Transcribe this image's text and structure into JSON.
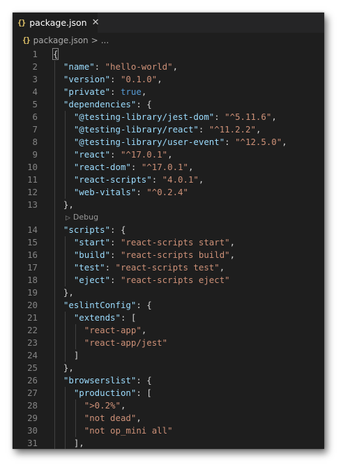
{
  "tab": {
    "icon": "json-braces-icon",
    "icon_text": "{}",
    "label": "package.json",
    "close_symbol": "✕"
  },
  "breadcrumb": {
    "icon_text": "{}",
    "file": "package.json",
    "separator": ">",
    "more": "..."
  },
  "codelens": {
    "label": "Debug",
    "icon": "play-icon"
  },
  "lines": [
    {
      "n": "1",
      "tokens": [
        {
          "t": "{",
          "c": "p"
        }
      ]
    },
    {
      "n": "2",
      "tokens": [
        {
          "t": "\"name\"",
          "c": "k"
        },
        {
          "t": ": ",
          "c": "p"
        },
        {
          "t": "\"hello-world\"",
          "c": "s"
        },
        {
          "t": ",",
          "c": "p"
        }
      ]
    },
    {
      "n": "3",
      "tokens": [
        {
          "t": "\"version\"",
          "c": "k"
        },
        {
          "t": ": ",
          "c": "p"
        },
        {
          "t": "\"0.1.0\"",
          "c": "s"
        },
        {
          "t": ",",
          "c": "p"
        }
      ]
    },
    {
      "n": "4",
      "tokens": [
        {
          "t": "\"private\"",
          "c": "k"
        },
        {
          "t": ": ",
          "c": "p"
        },
        {
          "t": "true",
          "c": "b"
        },
        {
          "t": ",",
          "c": "p"
        }
      ]
    },
    {
      "n": "5",
      "tokens": [
        {
          "t": "\"dependencies\"",
          "c": "k"
        },
        {
          "t": ": {",
          "c": "p"
        }
      ]
    },
    {
      "n": "6",
      "tokens": [
        {
          "t": "\"@testing-library/jest-dom\"",
          "c": "k"
        },
        {
          "t": ": ",
          "c": "p"
        },
        {
          "t": "\"^5.11.6\"",
          "c": "s"
        },
        {
          "t": ",",
          "c": "p"
        }
      ]
    },
    {
      "n": "7",
      "tokens": [
        {
          "t": "\"@testing-library/react\"",
          "c": "k"
        },
        {
          "t": ": ",
          "c": "p"
        },
        {
          "t": "\"^11.2.2\"",
          "c": "s"
        },
        {
          "t": ",",
          "c": "p"
        }
      ]
    },
    {
      "n": "8",
      "tokens": [
        {
          "t": "\"@testing-library/user-event\"",
          "c": "k"
        },
        {
          "t": ": ",
          "c": "p"
        },
        {
          "t": "\"^12.5.0\"",
          "c": "s"
        },
        {
          "t": ",",
          "c": "p"
        }
      ]
    },
    {
      "n": "9",
      "tokens": [
        {
          "t": "\"react\"",
          "c": "k"
        },
        {
          "t": ": ",
          "c": "p"
        },
        {
          "t": "\"^17.0.1\"",
          "c": "s"
        },
        {
          "t": ",",
          "c": "p"
        }
      ]
    },
    {
      "n": "10",
      "tokens": [
        {
          "t": "\"react-dom\"",
          "c": "k"
        },
        {
          "t": ": ",
          "c": "p"
        },
        {
          "t": "\"^17.0.1\"",
          "c": "s"
        },
        {
          "t": ",",
          "c": "p"
        }
      ]
    },
    {
      "n": "11",
      "tokens": [
        {
          "t": "\"react-scripts\"",
          "c": "k"
        },
        {
          "t": ": ",
          "c": "p"
        },
        {
          "t": "\"4.0.1\"",
          "c": "s"
        },
        {
          "t": ",",
          "c": "p"
        }
      ]
    },
    {
      "n": "12",
      "tokens": [
        {
          "t": "\"web-vitals\"",
          "c": "k"
        },
        {
          "t": ": ",
          "c": "p"
        },
        {
          "t": "\"^0.2.4\"",
          "c": "s"
        }
      ]
    },
    {
      "n": "13",
      "tokens": [
        {
          "t": "},",
          "c": "p"
        }
      ]
    },
    {
      "n": "14",
      "tokens": [
        {
          "t": "\"scripts\"",
          "c": "k"
        },
        {
          "t": ": {",
          "c": "p"
        }
      ]
    },
    {
      "n": "15",
      "tokens": [
        {
          "t": "\"start\"",
          "c": "k"
        },
        {
          "t": ": ",
          "c": "p"
        },
        {
          "t": "\"react-scripts start\"",
          "c": "s"
        },
        {
          "t": ",",
          "c": "p"
        }
      ]
    },
    {
      "n": "16",
      "tokens": [
        {
          "t": "\"build\"",
          "c": "k"
        },
        {
          "t": ": ",
          "c": "p"
        },
        {
          "t": "\"react-scripts build\"",
          "c": "s"
        },
        {
          "t": ",",
          "c": "p"
        }
      ]
    },
    {
      "n": "17",
      "tokens": [
        {
          "t": "\"test\"",
          "c": "k"
        },
        {
          "t": ": ",
          "c": "p"
        },
        {
          "t": "\"react-scripts test\"",
          "c": "s"
        },
        {
          "t": ",",
          "c": "p"
        }
      ]
    },
    {
      "n": "18",
      "tokens": [
        {
          "t": "\"eject\"",
          "c": "k"
        },
        {
          "t": ": ",
          "c": "p"
        },
        {
          "t": "\"react-scripts eject\"",
          "c": "s"
        }
      ]
    },
    {
      "n": "19",
      "tokens": [
        {
          "t": "},",
          "c": "p"
        }
      ]
    },
    {
      "n": "20",
      "tokens": [
        {
          "t": "\"eslintConfig\"",
          "c": "k"
        },
        {
          "t": ": {",
          "c": "p"
        }
      ]
    },
    {
      "n": "21",
      "tokens": [
        {
          "t": "\"extends\"",
          "c": "k"
        },
        {
          "t": ": [",
          "c": "p"
        }
      ]
    },
    {
      "n": "22",
      "tokens": [
        {
          "t": "\"react-app\"",
          "c": "s"
        },
        {
          "t": ",",
          "c": "p"
        }
      ]
    },
    {
      "n": "23",
      "tokens": [
        {
          "t": "\"react-app/jest\"",
          "c": "s"
        }
      ]
    },
    {
      "n": "24",
      "tokens": [
        {
          "t": "]",
          "c": "p"
        }
      ]
    },
    {
      "n": "25",
      "tokens": [
        {
          "t": "},",
          "c": "p"
        }
      ]
    },
    {
      "n": "26",
      "tokens": [
        {
          "t": "\"browserslist\"",
          "c": "k"
        },
        {
          "t": ": {",
          "c": "p"
        }
      ]
    },
    {
      "n": "27",
      "tokens": [
        {
          "t": "\"production\"",
          "c": "k"
        },
        {
          "t": ": [",
          "c": "p"
        }
      ]
    },
    {
      "n": "28",
      "tokens": [
        {
          "t": "\">0.2%\"",
          "c": "s"
        },
        {
          "t": ",",
          "c": "p"
        }
      ]
    },
    {
      "n": "29",
      "tokens": [
        {
          "t": "\"not dead\"",
          "c": "s"
        },
        {
          "t": ",",
          "c": "p"
        }
      ]
    },
    {
      "n": "30",
      "tokens": [
        {
          "t": "\"not op_mini all\"",
          "c": "s"
        }
      ]
    },
    {
      "n": "31",
      "tokens": [
        {
          "t": "],",
          "c": "p"
        }
      ]
    }
  ]
}
